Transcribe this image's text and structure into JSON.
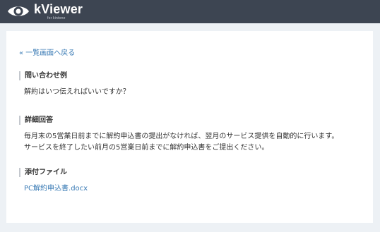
{
  "app": {
    "title": "kViewer",
    "subtitle": "for kintone",
    "logo_icon": "eye-icon"
  },
  "nav": {
    "back_link": "« 一覧画面へ戻る"
  },
  "sections": [
    {
      "title": "問い合わせ例",
      "lines": [
        "解約はいつ伝えればいいですか？"
      ]
    },
    {
      "title": "詳細回答",
      "lines": [
        "毎月末の5営業日前までに解約申込書の提出がなければ、翌月のサービス提供を自動的に行います。",
        "サービスを終了したい前月の5営業日前までに解約申込書をご提出ください。"
      ]
    },
    {
      "title": "添付ファイル",
      "file": "PC解約申込書.docx"
    }
  ],
  "colors": {
    "header_bg": "#3d4552",
    "page_bg": "#edf1f5",
    "link": "#3a7bb5"
  }
}
